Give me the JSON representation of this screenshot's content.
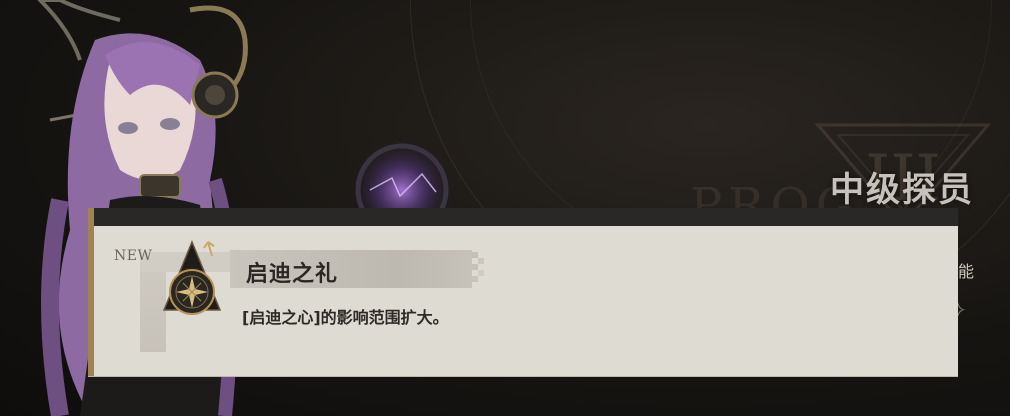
{
  "background": {
    "rank_title": "中级探员",
    "watermark": "PROG",
    "side_text": "能",
    "emblem_numeral": "III"
  },
  "notification": {
    "badge": "NEW",
    "skill_name": "启迪之礼",
    "skill_description": "[启迪之心]的影响范围扩大。",
    "icon": "compass-star-icon"
  },
  "colors": {
    "panel_bg": "#dedbd3",
    "panel_header": "#2a2826",
    "accent_gold": "#a08353",
    "title_bar": "#c5c0b8",
    "text_dark": "#2b2724"
  }
}
